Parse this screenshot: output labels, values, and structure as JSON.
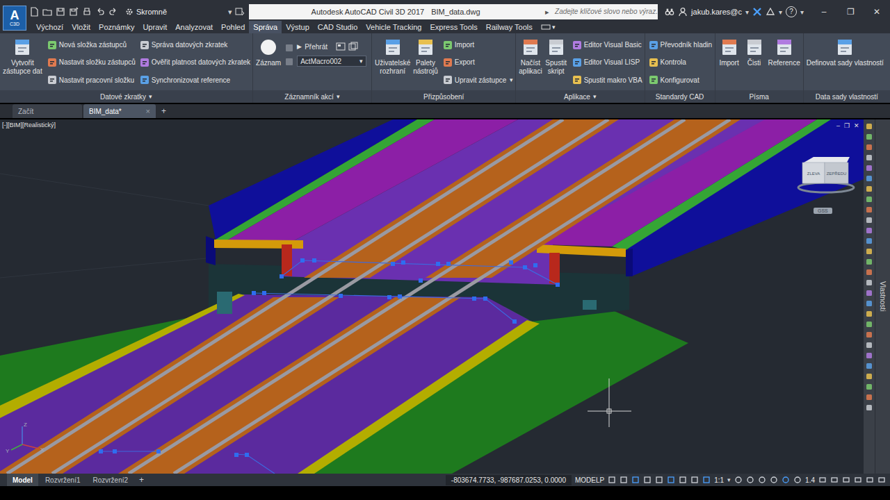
{
  "app": {
    "logo": "A",
    "logo_sub": "C3D",
    "workspace": "Skromně",
    "title": "Autodesk AutoCAD Civil 3D 2017",
    "file": "BIM_data.dwg",
    "search_arrow": "▸",
    "search_placeholder": "Zadejte klíčové slovo nebo výraz.",
    "user": "jakub.kares@c",
    "help": "?",
    "controls": [
      "–",
      "❐",
      "✕"
    ]
  },
  "menu_glyph": "▾",
  "ribbon_tabs": [
    {
      "label": "Výchozí",
      "selected": false
    },
    {
      "label": "Vložit",
      "selected": false
    },
    {
      "label": "Poznámky",
      "selected": false
    },
    {
      "label": "Upravit",
      "selected": false
    },
    {
      "label": "Analyzovat",
      "selected": false
    },
    {
      "label": "Pohled",
      "selected": false
    },
    {
      "label": "Správa",
      "selected": true
    },
    {
      "label": "Výstup",
      "selected": false
    },
    {
      "label": "CAD Studio",
      "selected": false
    },
    {
      "label": "Vehicle Tracking",
      "selected": false
    },
    {
      "label": "Express Tools",
      "selected": false
    },
    {
      "label": "Railway Tools",
      "selected": false
    }
  ],
  "panels": [
    {
      "title": "Datové zkratky",
      "has_menu": true,
      "groups": [
        {
          "kind": "large",
          "items": [
            {
              "lines": [
                "Vytvořit",
                "zástupce dat"
              ]
            }
          ]
        },
        {
          "kind": "stack",
          "items": [
            {
              "label": "Nová složka zástupců",
              "has_menu": false
            },
            {
              "label": "Nastavit složku zástupců",
              "has_menu": false
            },
            {
              "label": "Nastavit pracovní složku",
              "has_menu": false
            }
          ]
        },
        {
          "kind": "stack",
          "items": [
            {
              "label": "Správa datových zkratek",
              "has_menu": false
            },
            {
              "label": "Ověřit platnost datových zkratek",
              "has_menu": false
            },
            {
              "label": "Synchronizovat reference",
              "has_menu": false
            }
          ]
        }
      ]
    },
    {
      "title": "Záznamník akcí",
      "has_menu": true,
      "groups": [
        {
          "kind": "record",
          "items": [
            {
              "lines": [
                "Záznam"
              ]
            }
          ]
        },
        {
          "kind": "mini",
          "items": [
            {
              "disabled": true
            },
            {
              "disabled": true
            }
          ]
        },
        {
          "kind": "player",
          "play_glyph": "▶",
          "label": "Přehrát",
          "macro": "ActMacro002"
        }
      ]
    },
    {
      "title": "Přizpůsobení",
      "has_menu": false,
      "groups": [
        {
          "kind": "large",
          "items": [
            {
              "lines": [
                "Uživatelské",
                "rozhraní"
              ]
            },
            {
              "lines": [
                "Palety",
                "nástrojů"
              ]
            }
          ]
        },
        {
          "kind": "stack",
          "items": [
            {
              "label": "Import",
              "has_menu": false
            },
            {
              "label": "Export",
              "has_menu": false
            },
            {
              "label": "Upravit zástupce",
              "has_menu": true
            }
          ]
        }
      ]
    },
    {
      "title": "Aplikace",
      "has_menu": true,
      "groups": [
        {
          "kind": "large",
          "items": [
            {
              "lines": [
                "Načíst",
                "aplikaci"
              ]
            },
            {
              "lines": [
                "Spustit",
                "skript"
              ]
            }
          ]
        },
        {
          "kind": "stack",
          "items": [
            {
              "label": "Editor Visual Basic",
              "has_menu": false
            },
            {
              "label": "Editor Visual LISP",
              "has_menu": false
            },
            {
              "label": "Spustit makro VBA",
              "has_menu": false
            }
          ]
        }
      ]
    },
    {
      "title": "Standardy CAD",
      "has_menu": false,
      "groups": [
        {
          "kind": "stack",
          "items": [
            {
              "label": "Převodník hladin",
              "has_menu": false
            },
            {
              "label": "Kontrola",
              "has_menu": false
            },
            {
              "label": "Konfigurovat",
              "has_menu": false
            }
          ]
        }
      ]
    },
    {
      "title": "Písma",
      "has_menu": false,
      "groups": [
        {
          "kind": "large",
          "items": [
            {
              "lines": [
                "Import"
              ]
            },
            {
              "lines": [
                "Čisti"
              ]
            },
            {
              "lines": [
                "Reference"
              ]
            }
          ]
        }
      ]
    },
    {
      "title": "Data sady vlastností",
      "has_menu": false,
      "groups": [
        {
          "kind": "large",
          "items": [
            {
              "lines": [
                "Definovat sady vlastností"
              ]
            }
          ]
        }
      ]
    }
  ],
  "doc_tabs": {
    "tabs": [
      {
        "label": "Začít",
        "selected": false,
        "closable": false
      },
      {
        "label": "BIM_data*",
        "selected": true,
        "closable": true
      }
    ],
    "close_glyph": "×",
    "add_glyph": "+"
  },
  "viewport": {
    "label": "[-][BIM][Realistický]",
    "controls": [
      "–",
      "❐",
      "✕"
    ],
    "viewcube": {
      "left": "ZLEVA",
      "right": "ZEPŘEDU"
    },
    "ucs": "GSS",
    "axes": {
      "x": "X",
      "y": "Y",
      "z": "Z"
    }
  },
  "palette": {
    "label": "Vlastnosti"
  },
  "status_bar": {
    "layouts": [
      {
        "label": "Model",
        "selected": true
      },
      {
        "label": "Rozvržení1",
        "selected": false
      },
      {
        "label": "Rozvržení2",
        "selected": false
      }
    ],
    "add_glyph": "+",
    "coords": "-803674.7733, -987687.0253, 0.0000",
    "space": "MODELP",
    "scale": "1:1",
    "zoom": "1.4"
  }
}
